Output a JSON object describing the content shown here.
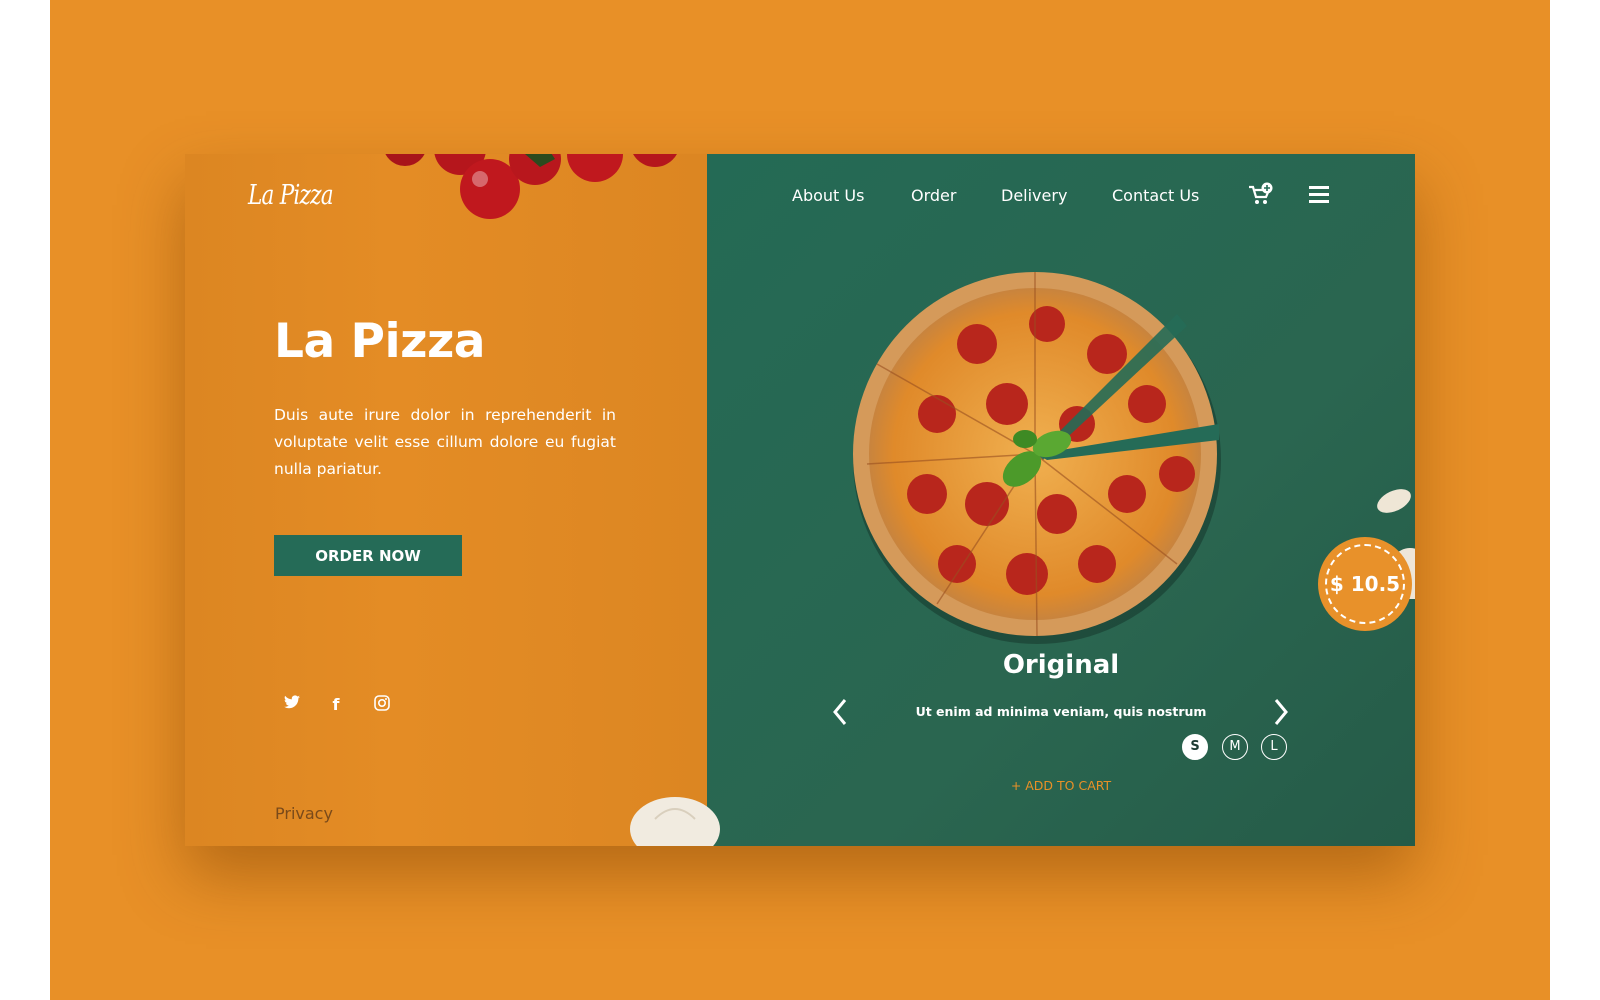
{
  "brand": {
    "logo": "La Pizza"
  },
  "hero": {
    "title": "La Pizza",
    "description": "Duis aute irure dolor in reprehenderit in voluptate velit esse cillum dolore eu fugiat nulla pariatur.",
    "cta": "ORDER NOW"
  },
  "social": [
    {
      "icon": "twitter-icon",
      "glyph": "🐦"
    },
    {
      "icon": "facebook-icon",
      "glyph": "f"
    },
    {
      "icon": "instagram-icon",
      "glyph": "◎"
    }
  ],
  "footer": {
    "privacy": "Privacy"
  },
  "nav": {
    "items": [
      "About Us",
      "Order",
      "Delivery",
      "Contact Us"
    ],
    "cart_icon": "cart-plus-icon",
    "menu_icon": "hamburger-menu-icon"
  },
  "product": {
    "name": "Original",
    "subtitle": "Ut enim ad minima veniam, quis nostrum",
    "price": "$ 10.5",
    "sizes": [
      "S",
      "M",
      "L"
    ],
    "selected_size": "S",
    "add_to_cart": "+ ADD TO CART",
    "prev_icon": "chevron-left-icon",
    "next_icon": "chevron-right-icon"
  },
  "colors": {
    "orange": "#e89027",
    "green": "#256b57",
    "white": "#ffffff"
  }
}
